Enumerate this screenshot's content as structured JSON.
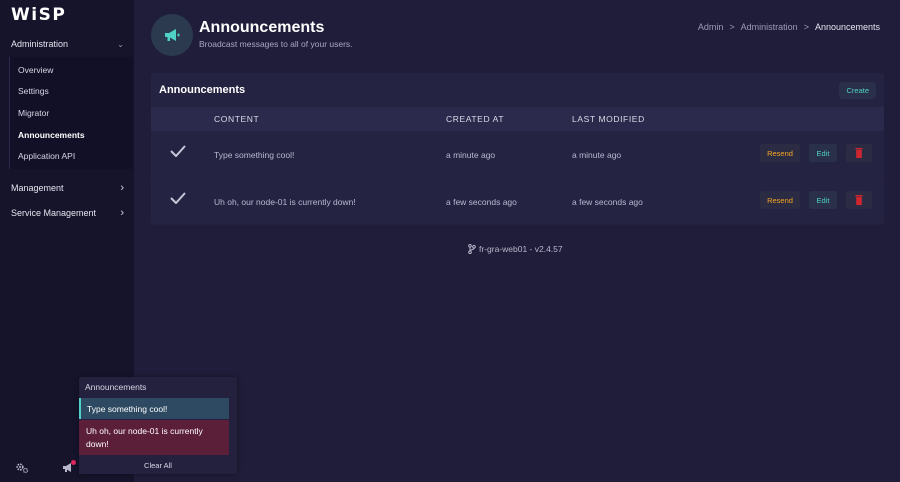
{
  "brand": {
    "logo": "WiSP"
  },
  "sidebar": {
    "groups": [
      {
        "label": "Administration",
        "expanded": true
      },
      {
        "label": "Management",
        "expanded": false
      },
      {
        "label": "Service Management",
        "expanded": false
      }
    ],
    "admin_items": [
      {
        "label": "Overview"
      },
      {
        "label": "Settings"
      },
      {
        "label": "Migrator"
      },
      {
        "label": "Announcements",
        "active": true
      },
      {
        "label": "Application API"
      }
    ],
    "chevron_down": "⌄",
    "chevron_right": "›"
  },
  "header": {
    "title": "Announcements",
    "subtitle": "Broadcast messages to all of your users.",
    "breadcrumb": [
      "Admin",
      "Administration",
      "Announcements"
    ],
    "separator": ">"
  },
  "panel": {
    "title": "Announcements",
    "create_label": "Create",
    "columns": [
      "CONTENT",
      "CREATED AT",
      "LAST MODIFIED"
    ],
    "rows": [
      {
        "content": "Type something cool!",
        "created": "a minute ago",
        "modified": "a minute ago"
      },
      {
        "content": "Uh oh, our node-01 is currently down!",
        "created": "a few seconds ago",
        "modified": "a few seconds ago"
      }
    ],
    "resend_label": "Resend",
    "edit_label": "Edit"
  },
  "footer": {
    "version": "fr-gra-web01 - v2.4.57"
  },
  "notifications": {
    "title": "Announcements",
    "items": [
      {
        "text": "Type something cool!"
      },
      {
        "text": "Uh oh, our node-01 is currently down!"
      }
    ],
    "clear_label": "Clear All"
  },
  "colors": {
    "accent": "#4fd1c5",
    "warning": "#f6a623",
    "danger": "#e0245e",
    "background": "#1f1d39",
    "sidebar": "#16142b"
  }
}
